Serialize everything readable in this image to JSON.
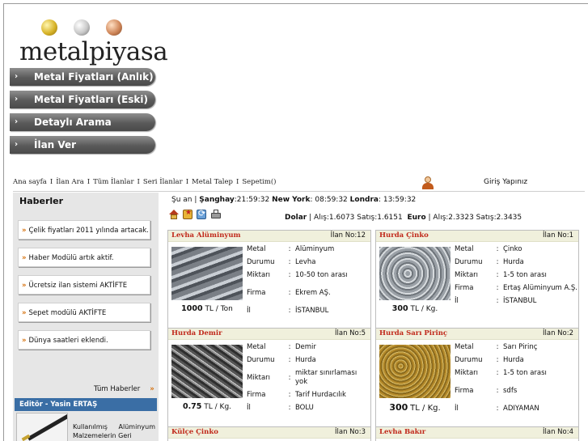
{
  "logo": {
    "text": "metalpiyasa"
  },
  "nav": [
    {
      "label": "Metal Fiyatları (Anlık)"
    },
    {
      "label": "Metal Fiyatları (Eski)"
    },
    {
      "label": "Detaylı Arama"
    },
    {
      "label": "İlan Ver"
    }
  ],
  "nav_arrow": "›",
  "toplinks": [
    "Ana sayfa",
    "İlan Ara",
    "Tüm İlanlar",
    "Seri İlanlar",
    "Metal Talep",
    "Sepetim()"
  ],
  "toplink_sep": "I",
  "login": "Giriş Yapınız",
  "news": {
    "title": "Haberler",
    "items": [
      "Çelik fiyatları 2011 yılında artacak.",
      "Haber Modülü artık aktif.",
      "Ücretsiz ilan sistemi AKTİFTE",
      "Sepet modülü AKTİFTE",
      "Dünya saatleri eklendi."
    ],
    "bullet": "»",
    "all_label": "Tüm Haberler"
  },
  "editor": {
    "title": "Editör - Yasin ERTAŞ",
    "text": "Kullanılmış Alüminyum Malzemelerin Geri"
  },
  "times": {
    "now_label": "Şu an |",
    "shanghai_label": "Şanghay",
    "shanghai": ":21:59:32",
    "ny_label": "New York",
    "ny": ": 08:59:32",
    "london_label": "Londra",
    "london": ": 13:59:32"
  },
  "rates": {
    "dollar_label": "Dolar",
    "dollar": "| Alış:1.6073  Satış:1.6151",
    "euro_label": "Euro",
    "euro": "| Alış:2.3323 Satış:2.3435"
  },
  "field_labels": {
    "metal": "Metal",
    "state": "Durumu",
    "amount": "Miktarı",
    "firm": "Firma",
    "city": "İl"
  },
  "colon": ":",
  "listings": [
    {
      "title": "Levha Alüminyum",
      "no": "İlan No:12",
      "price": "1000",
      "unit": "TL / Ton",
      "metal": "Alüminyum",
      "state": "Levha",
      "amount": "10-50 ton arası",
      "firm": "Ekrem AŞ.",
      "city": "İSTANBUL"
    },
    {
      "title": "Hurda Çinko",
      "no": "İlan No:1",
      "price": "300",
      "unit": "TL / Kg.",
      "metal": "Çinko",
      "state": "Hurda",
      "amount": "1-5 ton arası",
      "firm": "Ertaş Alüminyum A.Ş.",
      "city": "İSTANBUL"
    },
    {
      "title": "Hurda Demir",
      "no": "İlan No:5",
      "price": "0.75",
      "unit": "TL / Kg.",
      "metal": "Demir",
      "state": "Hurda",
      "amount": "miktar sınırlaması yok",
      "firm": "Tarif Hurdacılık",
      "city": "BOLU"
    },
    {
      "title": "Hurda Sarı Pirinç",
      "no": "İlan No:2",
      "price": "300",
      "unit": "TL / Kg.",
      "metal": "Sarı Pirinç",
      "state": "Hurda",
      "amount": "1-5 ton arası",
      "firm": "sdfs",
      "city": "ADIYAMAN"
    },
    {
      "title": "Külçe Çinko",
      "no": "İlan No:3"
    },
    {
      "title": "Levha Bakır",
      "no": "İlan No:4"
    }
  ]
}
